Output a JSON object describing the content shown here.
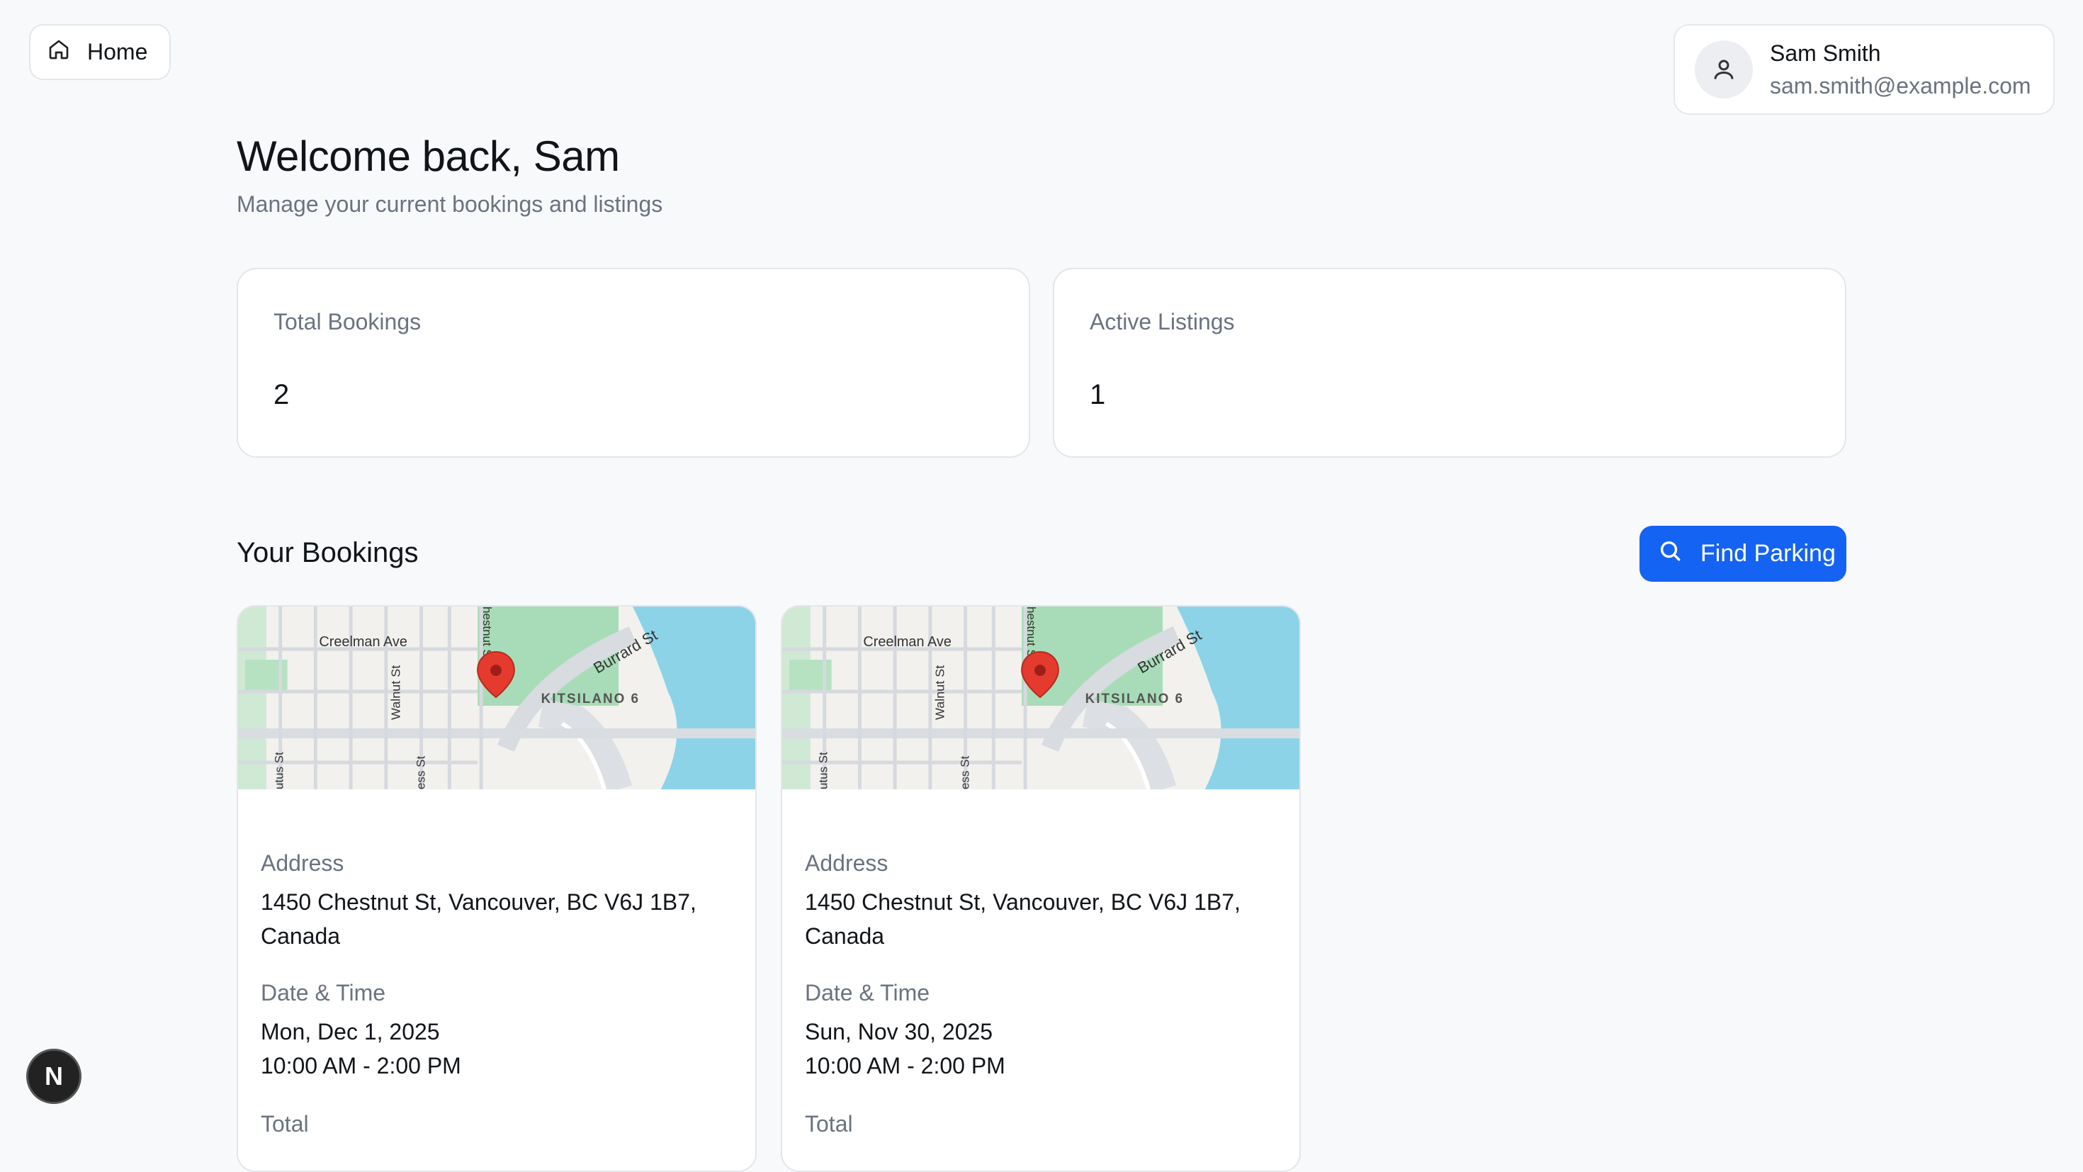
{
  "nav": {
    "home_label": "Home",
    "home_icon": "home-icon"
  },
  "user": {
    "name": "Sam Smith",
    "email": "sam.smith@example.com",
    "avatar_icon": "user-icon"
  },
  "header": {
    "title": "Welcome back, Sam",
    "subtitle": "Manage your current bookings and listings"
  },
  "stats": [
    {
      "label": "Total Bookings",
      "value": "2"
    },
    {
      "label": "Active Listings",
      "value": "1"
    }
  ],
  "bookings_section": {
    "title": "Your Bookings",
    "find_button": "Find Parking",
    "find_icon": "search-icon"
  },
  "map_labels": {
    "creelman": "Creelman Ave",
    "walnut": "Walnut St",
    "burrard": "Burrard St",
    "kitsilano": "KITSILANO 6",
    "chestnut": "hestnut S",
    "cypress": "ess St",
    "arbutus": "utus St"
  },
  "bookings": [
    {
      "address_label": "Address",
      "address": "1450 Chestnut St, Vancouver, BC V6J 1B7, Canada",
      "datetime_label": "Date & Time",
      "date": "Mon, Dec 1, 2025",
      "time": "10:00 AM - 2:00 PM",
      "total_label": "Total"
    },
    {
      "address_label": "Address",
      "address": "1450 Chestnut St, Vancouver, BC V6J 1B7, Canada",
      "datetime_label": "Date & Time",
      "date": "Sun, Nov 30, 2025",
      "time": "10:00 AM - 2:00 PM",
      "total_label": "Total"
    }
  ],
  "dev_badge": {
    "letter": "N"
  },
  "colors": {
    "primary": "#1463f3",
    "background": "#f8f9fb",
    "muted_text": "#6b7280",
    "pin": "#e53b2f",
    "water": "#8dd3e8",
    "park": "#a8dcb8"
  }
}
